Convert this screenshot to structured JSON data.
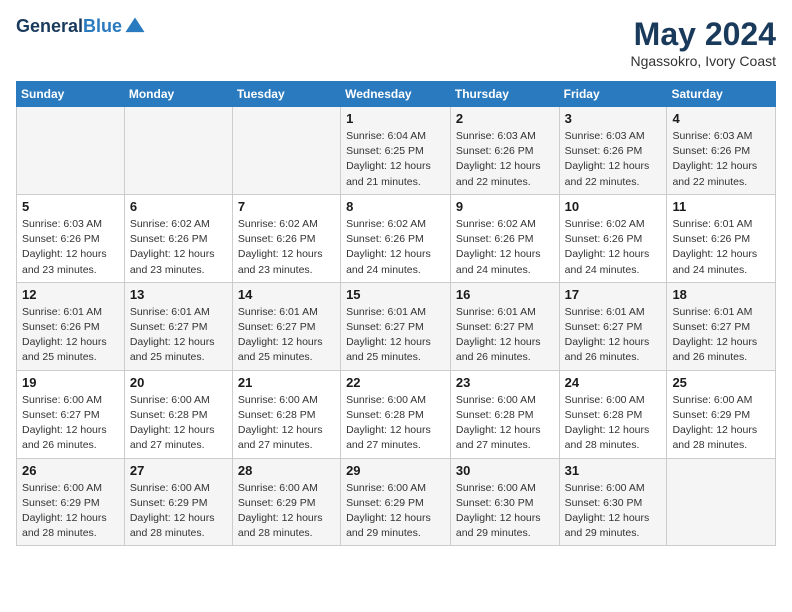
{
  "logo": {
    "line1": "General",
    "line2": "Blue"
  },
  "title": "May 2024",
  "location": "Ngassokro, Ivory Coast",
  "days_of_week": [
    "Sunday",
    "Monday",
    "Tuesday",
    "Wednesday",
    "Thursday",
    "Friday",
    "Saturday"
  ],
  "weeks": [
    [
      {
        "day": "",
        "info": ""
      },
      {
        "day": "",
        "info": ""
      },
      {
        "day": "",
        "info": ""
      },
      {
        "day": "1",
        "info": "Sunrise: 6:04 AM\nSunset: 6:25 PM\nDaylight: 12 hours\nand 21 minutes."
      },
      {
        "day": "2",
        "info": "Sunrise: 6:03 AM\nSunset: 6:26 PM\nDaylight: 12 hours\nand 22 minutes."
      },
      {
        "day": "3",
        "info": "Sunrise: 6:03 AM\nSunset: 6:26 PM\nDaylight: 12 hours\nand 22 minutes."
      },
      {
        "day": "4",
        "info": "Sunrise: 6:03 AM\nSunset: 6:26 PM\nDaylight: 12 hours\nand 22 minutes."
      }
    ],
    [
      {
        "day": "5",
        "info": "Sunrise: 6:03 AM\nSunset: 6:26 PM\nDaylight: 12 hours\nand 23 minutes."
      },
      {
        "day": "6",
        "info": "Sunrise: 6:02 AM\nSunset: 6:26 PM\nDaylight: 12 hours\nand 23 minutes."
      },
      {
        "day": "7",
        "info": "Sunrise: 6:02 AM\nSunset: 6:26 PM\nDaylight: 12 hours\nand 23 minutes."
      },
      {
        "day": "8",
        "info": "Sunrise: 6:02 AM\nSunset: 6:26 PM\nDaylight: 12 hours\nand 24 minutes."
      },
      {
        "day": "9",
        "info": "Sunrise: 6:02 AM\nSunset: 6:26 PM\nDaylight: 12 hours\nand 24 minutes."
      },
      {
        "day": "10",
        "info": "Sunrise: 6:02 AM\nSunset: 6:26 PM\nDaylight: 12 hours\nand 24 minutes."
      },
      {
        "day": "11",
        "info": "Sunrise: 6:01 AM\nSunset: 6:26 PM\nDaylight: 12 hours\nand 24 minutes."
      }
    ],
    [
      {
        "day": "12",
        "info": "Sunrise: 6:01 AM\nSunset: 6:26 PM\nDaylight: 12 hours\nand 25 minutes."
      },
      {
        "day": "13",
        "info": "Sunrise: 6:01 AM\nSunset: 6:27 PM\nDaylight: 12 hours\nand 25 minutes."
      },
      {
        "day": "14",
        "info": "Sunrise: 6:01 AM\nSunset: 6:27 PM\nDaylight: 12 hours\nand 25 minutes."
      },
      {
        "day": "15",
        "info": "Sunrise: 6:01 AM\nSunset: 6:27 PM\nDaylight: 12 hours\nand 25 minutes."
      },
      {
        "day": "16",
        "info": "Sunrise: 6:01 AM\nSunset: 6:27 PM\nDaylight: 12 hours\nand 26 minutes."
      },
      {
        "day": "17",
        "info": "Sunrise: 6:01 AM\nSunset: 6:27 PM\nDaylight: 12 hours\nand 26 minutes."
      },
      {
        "day": "18",
        "info": "Sunrise: 6:01 AM\nSunset: 6:27 PM\nDaylight: 12 hours\nand 26 minutes."
      }
    ],
    [
      {
        "day": "19",
        "info": "Sunrise: 6:00 AM\nSunset: 6:27 PM\nDaylight: 12 hours\nand 26 minutes."
      },
      {
        "day": "20",
        "info": "Sunrise: 6:00 AM\nSunset: 6:28 PM\nDaylight: 12 hours\nand 27 minutes."
      },
      {
        "day": "21",
        "info": "Sunrise: 6:00 AM\nSunset: 6:28 PM\nDaylight: 12 hours\nand 27 minutes."
      },
      {
        "day": "22",
        "info": "Sunrise: 6:00 AM\nSunset: 6:28 PM\nDaylight: 12 hours\nand 27 minutes."
      },
      {
        "day": "23",
        "info": "Sunrise: 6:00 AM\nSunset: 6:28 PM\nDaylight: 12 hours\nand 27 minutes."
      },
      {
        "day": "24",
        "info": "Sunrise: 6:00 AM\nSunset: 6:28 PM\nDaylight: 12 hours\nand 28 minutes."
      },
      {
        "day": "25",
        "info": "Sunrise: 6:00 AM\nSunset: 6:29 PM\nDaylight: 12 hours\nand 28 minutes."
      }
    ],
    [
      {
        "day": "26",
        "info": "Sunrise: 6:00 AM\nSunset: 6:29 PM\nDaylight: 12 hours\nand 28 minutes."
      },
      {
        "day": "27",
        "info": "Sunrise: 6:00 AM\nSunset: 6:29 PM\nDaylight: 12 hours\nand 28 minutes."
      },
      {
        "day": "28",
        "info": "Sunrise: 6:00 AM\nSunset: 6:29 PM\nDaylight: 12 hours\nand 28 minutes."
      },
      {
        "day": "29",
        "info": "Sunrise: 6:00 AM\nSunset: 6:29 PM\nDaylight: 12 hours\nand 29 minutes."
      },
      {
        "day": "30",
        "info": "Sunrise: 6:00 AM\nSunset: 6:30 PM\nDaylight: 12 hours\nand 29 minutes."
      },
      {
        "day": "31",
        "info": "Sunrise: 6:00 AM\nSunset: 6:30 PM\nDaylight: 12 hours\nand 29 minutes."
      },
      {
        "day": "",
        "info": ""
      }
    ]
  ]
}
